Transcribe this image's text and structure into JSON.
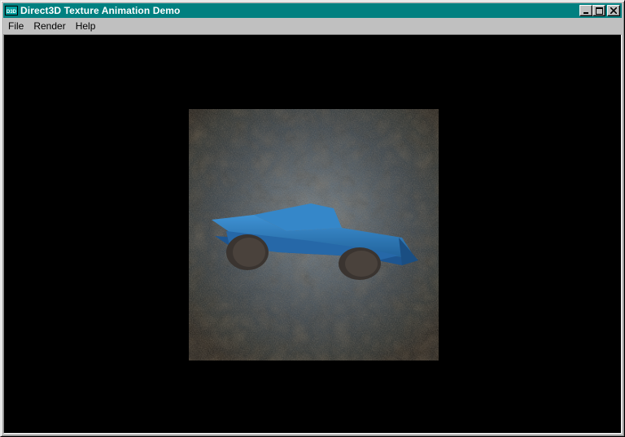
{
  "window": {
    "title": "Direct3D Texture Animation Demo",
    "icon": "d3d-app-icon",
    "title_bar_color": "#008080",
    "controls": [
      "minimize",
      "maximize",
      "close"
    ]
  },
  "menubar": {
    "items": [
      {
        "label": "File"
      },
      {
        "label": "Render"
      },
      {
        "label": "Help"
      }
    ]
  },
  "scene": {
    "background_color": "#000000",
    "texture": "animated-rock-texture",
    "object": "blue-car-model",
    "object_color": "#2e7fc0"
  }
}
